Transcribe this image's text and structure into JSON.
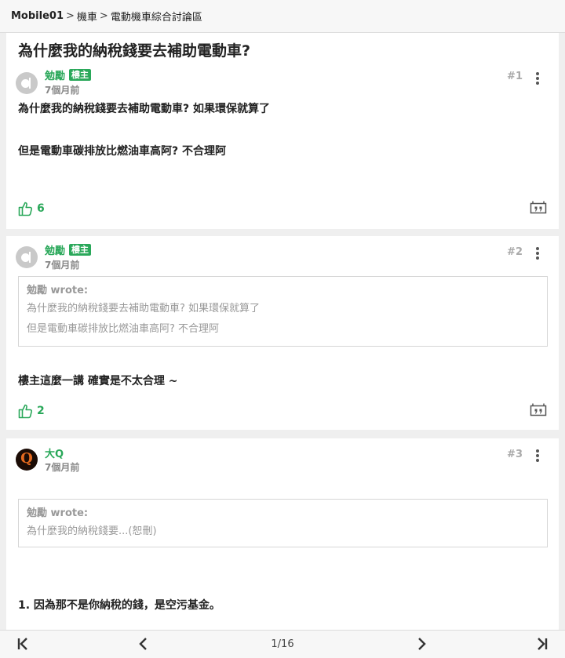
{
  "breadcrumb": {
    "site": "Mobile01",
    "separator": ">",
    "category": "機車",
    "forum": "電動機車綜合討論區"
  },
  "thread": {
    "title": "為什麼我的納稅錢要去補助電動車?"
  },
  "posts": [
    {
      "author": "勉勵",
      "badge": "樓主",
      "time": "7個月前",
      "floor": "#1",
      "lines": [
        "為什麼我的納稅錢要去補助電動車? 如果環保就算了",
        "但是電動車碳排放比燃油車高阿? 不合理阿"
      ],
      "likes": "6"
    },
    {
      "author": "勉勵",
      "badge": "樓主",
      "time": "7個月前",
      "floor": "#2",
      "quote": {
        "head": "勉勵 wrote:",
        "lines": [
          "為什麼我的納稅錢要去補助電動車? 如果環保就算了",
          "但是電動車碳排放比燃油車高阿? 不合理阿"
        ]
      },
      "lines": [
        "樓主這麼一講 確實是不太合理 ~"
      ],
      "likes": "2"
    },
    {
      "author": "大Q",
      "avatar_letter": "Q",
      "time": "7個月前",
      "floor": "#3",
      "quote": {
        "head": "勉勵 wrote:",
        "lines": [
          "為什麼我的納稅錢要...(恕刪)"
        ]
      },
      "lines": [
        "1. 因為那不是你納稅的錢，是空污基金。"
      ]
    }
  ],
  "pagination": {
    "page": "1/16"
  },
  "icons": {
    "like": "thumbs-up-icon",
    "reply": "quote-reply-icon",
    "more": "more-vertical-icon",
    "first": "first-page-icon",
    "prev": "previous-page-icon",
    "next": "next-page-icon",
    "last": "last-page-icon"
  },
  "colors": {
    "accent": "#2aa85a",
    "background": "#efefef",
    "muted": "#999999"
  }
}
